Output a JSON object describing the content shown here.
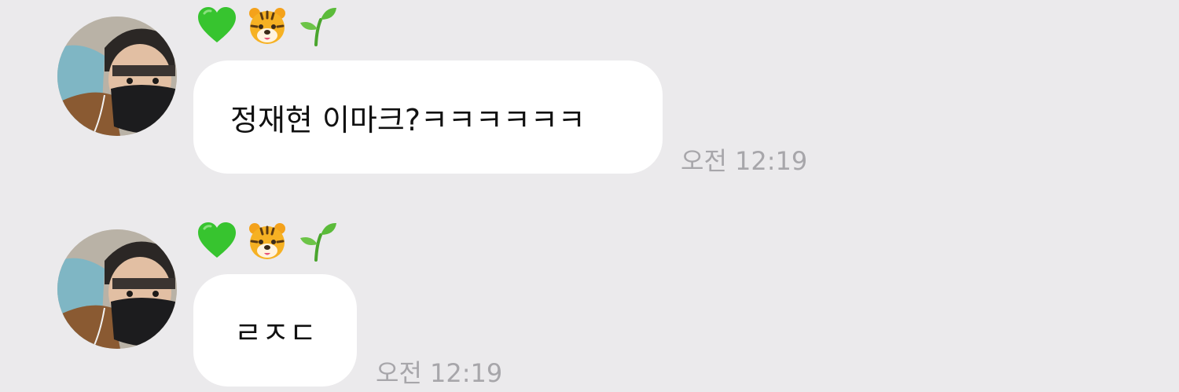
{
  "chat": {
    "messages": [
      {
        "sender_name_icons": [
          "green-heart-icon",
          "tiger-face-icon",
          "seedling-icon"
        ],
        "text": "정재현 이마크?ㅋㅋㅋㅋㅋㅋ",
        "time": "오전 12:19"
      },
      {
        "sender_name_icons": [
          "green-heart-icon",
          "tiger-face-icon",
          "seedling-icon"
        ],
        "text": "ㄹㅈㄷ",
        "time": "오전 12:19"
      }
    ]
  },
  "colors": {
    "background": "#ebeaec",
    "bubble": "#ffffff",
    "text": "#111111",
    "timestamp": "#a7a6aa",
    "heart": "#3cc63a"
  }
}
